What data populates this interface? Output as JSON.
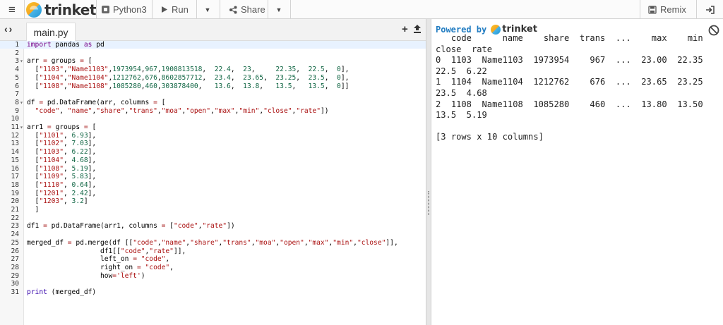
{
  "toolbar": {
    "brand": "trinket",
    "language": "Python3",
    "run_label": "Run",
    "share_label": "Share",
    "remix_label": "Remix"
  },
  "editor": {
    "tab_label": "main.py",
    "lines": [
      {
        "n": "1",
        "fold": "",
        "active": true,
        "tokens": [
          {
            "t": "import",
            "c": "k"
          },
          {
            "t": " pandas "
          },
          {
            "t": "as",
            "c": "k"
          },
          {
            "t": " pd"
          }
        ]
      },
      {
        "n": "2",
        "fold": "",
        "tokens": []
      },
      {
        "n": "3",
        "fold": "▾",
        "tokens": [
          {
            "t": "arr "
          },
          {
            "t": "=",
            "c": "o"
          },
          {
            "t": " groups "
          },
          {
            "t": "=",
            "c": "o"
          },
          {
            "t": " ["
          }
        ]
      },
      {
        "n": "4",
        "fold": "",
        "tokens": [
          {
            "t": "  ["
          },
          {
            "t": "\"1103\"",
            "c": "s"
          },
          {
            "t": ","
          },
          {
            "t": "\"Name1103\"",
            "c": "s"
          },
          {
            "t": ","
          },
          {
            "t": "1973954",
            "c": "n"
          },
          {
            "t": ","
          },
          {
            "t": "967",
            "c": "n"
          },
          {
            "t": ","
          },
          {
            "t": "1908813518",
            "c": "n"
          },
          {
            "t": ",  "
          },
          {
            "t": "22.4",
            "c": "n"
          },
          {
            "t": ",  "
          },
          {
            "t": "23",
            "c": "n"
          },
          {
            "t": ",     "
          },
          {
            "t": "22.35",
            "c": "n"
          },
          {
            "t": ",  "
          },
          {
            "t": "22.5",
            "c": "n"
          },
          {
            "t": ",  "
          },
          {
            "t": "0",
            "c": "n"
          },
          {
            "t": "],"
          }
        ]
      },
      {
        "n": "5",
        "fold": "",
        "tokens": [
          {
            "t": "  ["
          },
          {
            "t": "\"1104\"",
            "c": "s"
          },
          {
            "t": ","
          },
          {
            "t": "\"Name1104\"",
            "c": "s"
          },
          {
            "t": ","
          },
          {
            "t": "1212762",
            "c": "n"
          },
          {
            "t": ","
          },
          {
            "t": "676",
            "c": "n"
          },
          {
            "t": ","
          },
          {
            "t": "8602857712",
            "c": "n"
          },
          {
            "t": ",  "
          },
          {
            "t": "23.4",
            "c": "n"
          },
          {
            "t": ",  "
          },
          {
            "t": "23.65",
            "c": "n"
          },
          {
            "t": ",  "
          },
          {
            "t": "23.25",
            "c": "n"
          },
          {
            "t": ",  "
          },
          {
            "t": "23.5",
            "c": "n"
          },
          {
            "t": ",  "
          },
          {
            "t": "0",
            "c": "n"
          },
          {
            "t": "],"
          }
        ]
      },
      {
        "n": "6",
        "fold": "",
        "tokens": [
          {
            "t": "  ["
          },
          {
            "t": "\"1108\"",
            "c": "s"
          },
          {
            "t": ","
          },
          {
            "t": "\"Name1108\"",
            "c": "s"
          },
          {
            "t": ","
          },
          {
            "t": "1085280",
            "c": "n"
          },
          {
            "t": ","
          },
          {
            "t": "460",
            "c": "n"
          },
          {
            "t": ","
          },
          {
            "t": "303878400",
            "c": "n"
          },
          {
            "t": ",   "
          },
          {
            "t": "13.6",
            "c": "n"
          },
          {
            "t": ",  "
          },
          {
            "t": "13.8",
            "c": "n"
          },
          {
            "t": ",   "
          },
          {
            "t": "13.5",
            "c": "n"
          },
          {
            "t": ",   "
          },
          {
            "t": "13.5",
            "c": "n"
          },
          {
            "t": ",  "
          },
          {
            "t": "0",
            "c": "n"
          },
          {
            "t": "]]"
          }
        ]
      },
      {
        "n": "7",
        "fold": "",
        "tokens": []
      },
      {
        "n": "8",
        "fold": "▾",
        "tokens": [
          {
            "t": "df "
          },
          {
            "t": "=",
            "c": "o"
          },
          {
            "t": " pd.DataFrame(arr, columns "
          },
          {
            "t": "=",
            "c": "o"
          },
          {
            "t": " ["
          }
        ]
      },
      {
        "n": "9",
        "fold": "",
        "tokens": [
          {
            "t": "  "
          },
          {
            "t": "\"code\"",
            "c": "s"
          },
          {
            "t": ", "
          },
          {
            "t": "\"name\"",
            "c": "s"
          },
          {
            "t": ","
          },
          {
            "t": "\"share\"",
            "c": "s"
          },
          {
            "t": ","
          },
          {
            "t": "\"trans\"",
            "c": "s"
          },
          {
            "t": ","
          },
          {
            "t": "\"moa\"",
            "c": "s"
          },
          {
            "t": ","
          },
          {
            "t": "\"open\"",
            "c": "s"
          },
          {
            "t": ","
          },
          {
            "t": "\"max\"",
            "c": "s"
          },
          {
            "t": ","
          },
          {
            "t": "\"min\"",
            "c": "s"
          },
          {
            "t": ","
          },
          {
            "t": "\"close\"",
            "c": "s"
          },
          {
            "t": ","
          },
          {
            "t": "\"rate\"",
            "c": "s"
          },
          {
            "t": "])"
          }
        ]
      },
      {
        "n": "10",
        "fold": "",
        "tokens": []
      },
      {
        "n": "11",
        "fold": "▾",
        "tokens": [
          {
            "t": "arr1 "
          },
          {
            "t": "=",
            "c": "o"
          },
          {
            "t": " groups "
          },
          {
            "t": "=",
            "c": "o"
          },
          {
            "t": " ["
          }
        ]
      },
      {
        "n": "12",
        "fold": "",
        "tokens": [
          {
            "t": "  ["
          },
          {
            "t": "\"1101\"",
            "c": "s"
          },
          {
            "t": ", "
          },
          {
            "t": "6.93",
            "c": "n"
          },
          {
            "t": "],"
          }
        ]
      },
      {
        "n": "13",
        "fold": "",
        "tokens": [
          {
            "t": "  ["
          },
          {
            "t": "\"1102\"",
            "c": "s"
          },
          {
            "t": ", "
          },
          {
            "t": "7.03",
            "c": "n"
          },
          {
            "t": "],"
          }
        ]
      },
      {
        "n": "14",
        "fold": "",
        "tokens": [
          {
            "t": "  ["
          },
          {
            "t": "\"1103\"",
            "c": "s"
          },
          {
            "t": ", "
          },
          {
            "t": "6.22",
            "c": "n"
          },
          {
            "t": "],"
          }
        ]
      },
      {
        "n": "15",
        "fold": "",
        "tokens": [
          {
            "t": "  ["
          },
          {
            "t": "\"1104\"",
            "c": "s"
          },
          {
            "t": ", "
          },
          {
            "t": "4.68",
            "c": "n"
          },
          {
            "t": "],"
          }
        ]
      },
      {
        "n": "16",
        "fold": "",
        "tokens": [
          {
            "t": "  ["
          },
          {
            "t": "\"1108\"",
            "c": "s"
          },
          {
            "t": ", "
          },
          {
            "t": "5.19",
            "c": "n"
          },
          {
            "t": "],"
          }
        ]
      },
      {
        "n": "17",
        "fold": "",
        "tokens": [
          {
            "t": "  ["
          },
          {
            "t": "\"1109\"",
            "c": "s"
          },
          {
            "t": ", "
          },
          {
            "t": "5.83",
            "c": "n"
          },
          {
            "t": "],"
          }
        ]
      },
      {
        "n": "18",
        "fold": "",
        "tokens": [
          {
            "t": "  ["
          },
          {
            "t": "\"1110\"",
            "c": "s"
          },
          {
            "t": ", "
          },
          {
            "t": "0.64",
            "c": "n"
          },
          {
            "t": "],"
          }
        ]
      },
      {
        "n": "19",
        "fold": "",
        "tokens": [
          {
            "t": "  ["
          },
          {
            "t": "\"1201\"",
            "c": "s"
          },
          {
            "t": ", "
          },
          {
            "t": "2.42",
            "c": "n"
          },
          {
            "t": "],"
          }
        ]
      },
      {
        "n": "20",
        "fold": "",
        "tokens": [
          {
            "t": "  ["
          },
          {
            "t": "\"1203\"",
            "c": "s"
          },
          {
            "t": ", "
          },
          {
            "t": "3.2",
            "c": "n"
          },
          {
            "t": "]"
          }
        ]
      },
      {
        "n": "21",
        "fold": "",
        "tokens": [
          {
            "t": "  ]"
          }
        ]
      },
      {
        "n": "22",
        "fold": "",
        "tokens": []
      },
      {
        "n": "23",
        "fold": "",
        "tokens": [
          {
            "t": "df1 "
          },
          {
            "t": "=",
            "c": "o"
          },
          {
            "t": " pd.DataFrame(arr1, columns "
          },
          {
            "t": "=",
            "c": "o"
          },
          {
            "t": " ["
          },
          {
            "t": "\"code\"",
            "c": "s"
          },
          {
            "t": ","
          },
          {
            "t": "\"rate\"",
            "c": "s"
          },
          {
            "t": "])"
          }
        ]
      },
      {
        "n": "24",
        "fold": "",
        "tokens": []
      },
      {
        "n": "25",
        "fold": "",
        "tokens": [
          {
            "t": "merged_df "
          },
          {
            "t": "=",
            "c": "o"
          },
          {
            "t": " pd.merge(df [["
          },
          {
            "t": "\"code\"",
            "c": "s"
          },
          {
            "t": ","
          },
          {
            "t": "\"name\"",
            "c": "s"
          },
          {
            "t": ","
          },
          {
            "t": "\"share\"",
            "c": "s"
          },
          {
            "t": ","
          },
          {
            "t": "\"trans\"",
            "c": "s"
          },
          {
            "t": ","
          },
          {
            "t": "\"moa\"",
            "c": "s"
          },
          {
            "t": ","
          },
          {
            "t": "\"open\"",
            "c": "s"
          },
          {
            "t": ","
          },
          {
            "t": "\"max\"",
            "c": "s"
          },
          {
            "t": ","
          },
          {
            "t": "\"min\"",
            "c": "s"
          },
          {
            "t": ","
          },
          {
            "t": "\"close\"",
            "c": "s"
          },
          {
            "t": "]],"
          }
        ]
      },
      {
        "n": "26",
        "fold": "",
        "tokens": [
          {
            "t": "                  df1[["
          },
          {
            "t": "\"code\"",
            "c": "s"
          },
          {
            "t": ","
          },
          {
            "t": "\"rate\"",
            "c": "s"
          },
          {
            "t": "]],"
          }
        ]
      },
      {
        "n": "27",
        "fold": "",
        "tokens": [
          {
            "t": "                  left_on "
          },
          {
            "t": "=",
            "c": "o"
          },
          {
            "t": " "
          },
          {
            "t": "\"code\"",
            "c": "s"
          },
          {
            "t": ","
          }
        ]
      },
      {
        "n": "28",
        "fold": "",
        "tokens": [
          {
            "t": "                  right_on "
          },
          {
            "t": "=",
            "c": "o"
          },
          {
            "t": " "
          },
          {
            "t": "\"code\"",
            "c": "s"
          },
          {
            "t": ","
          }
        ]
      },
      {
        "n": "29",
        "fold": "",
        "tokens": [
          {
            "t": "                  how"
          },
          {
            "t": "=",
            "c": "o"
          },
          {
            "t": "'left'",
            "c": "s"
          },
          {
            "t": ")"
          }
        ]
      },
      {
        "n": "30",
        "fold": "",
        "tokens": []
      },
      {
        "n": "31",
        "fold": "",
        "tokens": [
          {
            "t": "print",
            "c": "b"
          },
          {
            "t": " (merged_df)"
          }
        ]
      }
    ]
  },
  "output": {
    "powered_by": "Powered by",
    "brand": "trinket",
    "lines": [
      "   code      name    share  trans  ...    max    min",
      "close  rate",
      "0  1103  Name1103  1973954    967  ...  23.00  22.35",
      "22.5  6.22",
      "1  1104  Name1104  1212762    676  ...  23.65  23.25",
      "23.5  4.68",
      "2  1108  Name1108  1085280    460  ...  13.80  13.50",
      "13.5  5.19",
      "",
      "[3 rows x 10 columns]"
    ]
  }
}
